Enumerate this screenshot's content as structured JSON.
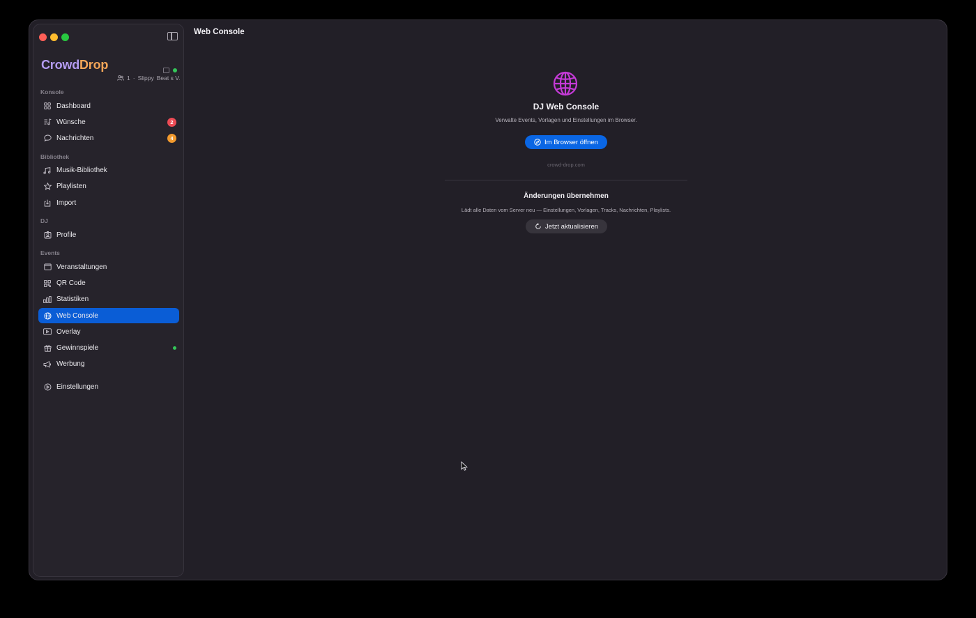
{
  "window": {
    "title": "Web Console"
  },
  "brand": {
    "part1": "Crowd",
    "part2": "Drop"
  },
  "session": {
    "count": "1",
    "dj": "Slippy",
    "event": "Beat s V..."
  },
  "sidebar": {
    "sections": [
      {
        "label": "Konsole",
        "items": [
          {
            "label": "Dashboard",
            "icon": "grid-icon"
          },
          {
            "label": "Wünsche",
            "icon": "music-list-icon",
            "badge": "2",
            "badge_color": "#ec4b55"
          },
          {
            "label": "Nachrichten",
            "icon": "speech-bubble-icon",
            "badge": "4",
            "badge_color": "#f29a2e"
          }
        ]
      },
      {
        "label": "Bibliothek",
        "items": [
          {
            "label": "Musik-Bibliothek",
            "icon": "music-notes-icon"
          },
          {
            "label": "Playlisten",
            "icon": "star-icon"
          },
          {
            "label": "Import",
            "icon": "import-icon"
          }
        ]
      },
      {
        "label": "DJ",
        "items": [
          {
            "label": "Profile",
            "icon": "person-card-icon"
          }
        ]
      },
      {
        "label": "Events",
        "items": [
          {
            "label": "Veranstaltungen",
            "icon": "calendar-icon"
          },
          {
            "label": "QR Code",
            "icon": "qr-code-icon"
          },
          {
            "label": "Statistiken",
            "icon": "bar-chart-icon"
          },
          {
            "label": "Web Console",
            "icon": "globe-icon",
            "active": true
          },
          {
            "label": "Overlay",
            "icon": "overlay-icon"
          },
          {
            "label": "Gewinnspiele",
            "icon": "gift-icon",
            "dot": "#34c759"
          },
          {
            "label": "Werbung",
            "icon": "megaphone-icon"
          }
        ]
      }
    ],
    "settings": {
      "label": "Einstellungen",
      "icon": "gear-icon"
    }
  },
  "main": {
    "heading": "DJ Web Console",
    "subtitle": "Verwalte Events, Vorlagen und Einstellungen im Browser.",
    "open_button": "Im Browser öffnen",
    "domain": "crowd-drop.com",
    "apply_heading": "Änderungen übernehmen",
    "apply_subtitle": "Lädt alle Daten vom Server neu — Einstellungen, Vorlagen, Tracks, Nachrichten, Playlists.",
    "refresh_button": "Jetzt aktualisieren"
  },
  "colors": {
    "accent": "#0a66e4",
    "active_nav": "#0a5dd6",
    "globe": "#c43ad6",
    "brand_purple": "#b49cf2",
    "brand_orange": "#f4a658"
  }
}
